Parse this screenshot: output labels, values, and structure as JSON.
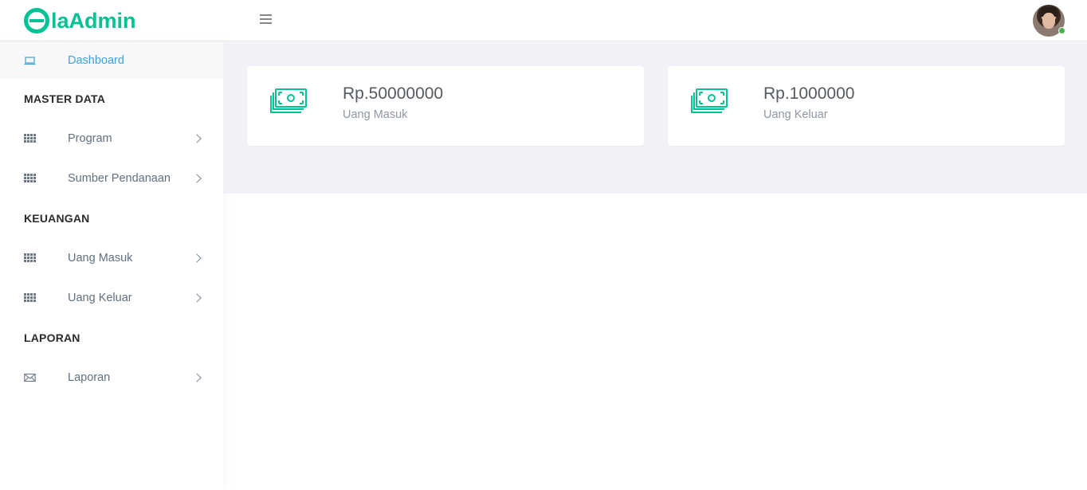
{
  "header": {
    "logo_text": "elaAdmin",
    "logo_prefix": "e",
    "logo_rest": "laAdmin",
    "menu_icon": "hamburger-icon",
    "avatar_status_color": "#4caf50"
  },
  "sidebar": {
    "dashboard": {
      "label": "Dashboard",
      "icon": "laptop-icon"
    },
    "sections": [
      {
        "title": "MASTER DATA"
      },
      {
        "title": "KEUANGAN"
      },
      {
        "title": "LAPORAN"
      }
    ],
    "items": [
      {
        "label": "Program",
        "icon": "grid-icon"
      },
      {
        "label": "Sumber Pendanaan",
        "icon": "grid-icon"
      },
      {
        "label": "Uang Masuk",
        "icon": "grid-icon"
      },
      {
        "label": "Uang Keluar",
        "icon": "grid-icon"
      },
      {
        "label": "Laporan",
        "icon": "envelope-icon"
      }
    ]
  },
  "cards": [
    {
      "value": "Rp.50000000",
      "label": "Uang Masuk",
      "icon": "money-icon"
    },
    {
      "value": "Rp.1000000",
      "label": "Uang Keluar",
      "icon": "money-icon"
    }
  ],
  "colors": {
    "accent": "#00c292",
    "active_link": "#3fa1d8",
    "content_bg": "#f1f2f7"
  }
}
